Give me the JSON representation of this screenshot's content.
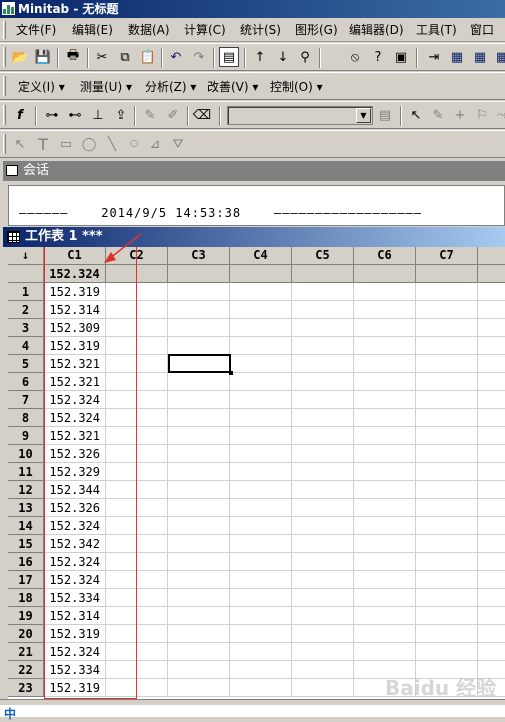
{
  "app": {
    "title": "Minitab - 无标题"
  },
  "menu": [
    "文件(F)",
    "编辑(E)",
    "数据(A)",
    "计算(C)",
    "统计(S)",
    "图形(G)",
    "编辑器(D)",
    "工具(T)",
    "窗口"
  ],
  "menu2": [
    "定义(I) ▾",
    "测量(U) ▾",
    "分析(Z) ▾",
    "改善(V) ▾",
    "控制(O) ▾"
  ],
  "toolbar": {
    "icons": [
      "open-icon",
      "save-icon",
      "print-icon",
      "cut-icon",
      "copy-icon",
      "paste-icon",
      "undo-icon",
      "redo-icon",
      "show-worksheet-icon",
      "up-arrow-icon",
      "down-arrow-icon",
      "find-icon",
      "cancel-icon",
      "help-icon",
      "session-icon"
    ],
    "combo_value": ""
  },
  "session": {
    "title": "会话",
    "line": "——————    2014/9/5 14:53:38    ——————————————————"
  },
  "worksheet": {
    "title": "工作表 1 ***",
    "corner": "↓",
    "columns": [
      "C1",
      "C2",
      "C3",
      "C4",
      "C5",
      "C6",
      "C7",
      "C"
    ],
    "column_name_c1": "152.324",
    "rows": [
      {
        "n": "1",
        "v": "152.319"
      },
      {
        "n": "2",
        "v": "152.314"
      },
      {
        "n": "3",
        "v": "152.309"
      },
      {
        "n": "4",
        "v": "152.319"
      },
      {
        "n": "5",
        "v": "152.321"
      },
      {
        "n": "6",
        "v": "152.321"
      },
      {
        "n": "7",
        "v": "152.324"
      },
      {
        "n": "8",
        "v": "152.324"
      },
      {
        "n": "9",
        "v": "152.321"
      },
      {
        "n": "10",
        "v": "152.326"
      },
      {
        "n": "11",
        "v": "152.329"
      },
      {
        "n": "12",
        "v": "152.344"
      },
      {
        "n": "13",
        "v": "152.326"
      },
      {
        "n": "14",
        "v": "152.324"
      },
      {
        "n": "15",
        "v": "152.342"
      },
      {
        "n": "16",
        "v": "152.324"
      },
      {
        "n": "17",
        "v": "152.324"
      },
      {
        "n": "18",
        "v": "152.334"
      },
      {
        "n": "19",
        "v": "152.314"
      },
      {
        "n": "20",
        "v": "152.319"
      },
      {
        "n": "21",
        "v": "152.324"
      },
      {
        "n": "22",
        "v": "152.334"
      },
      {
        "n": "23",
        "v": "152.319"
      }
    ]
  },
  "taskbar": {
    "ime": "中"
  },
  "watermark": "Baidu 经验",
  "colors": {
    "title_active": "#0a246a",
    "title_inactive": "#808080",
    "annotation_red": "#e03030"
  }
}
